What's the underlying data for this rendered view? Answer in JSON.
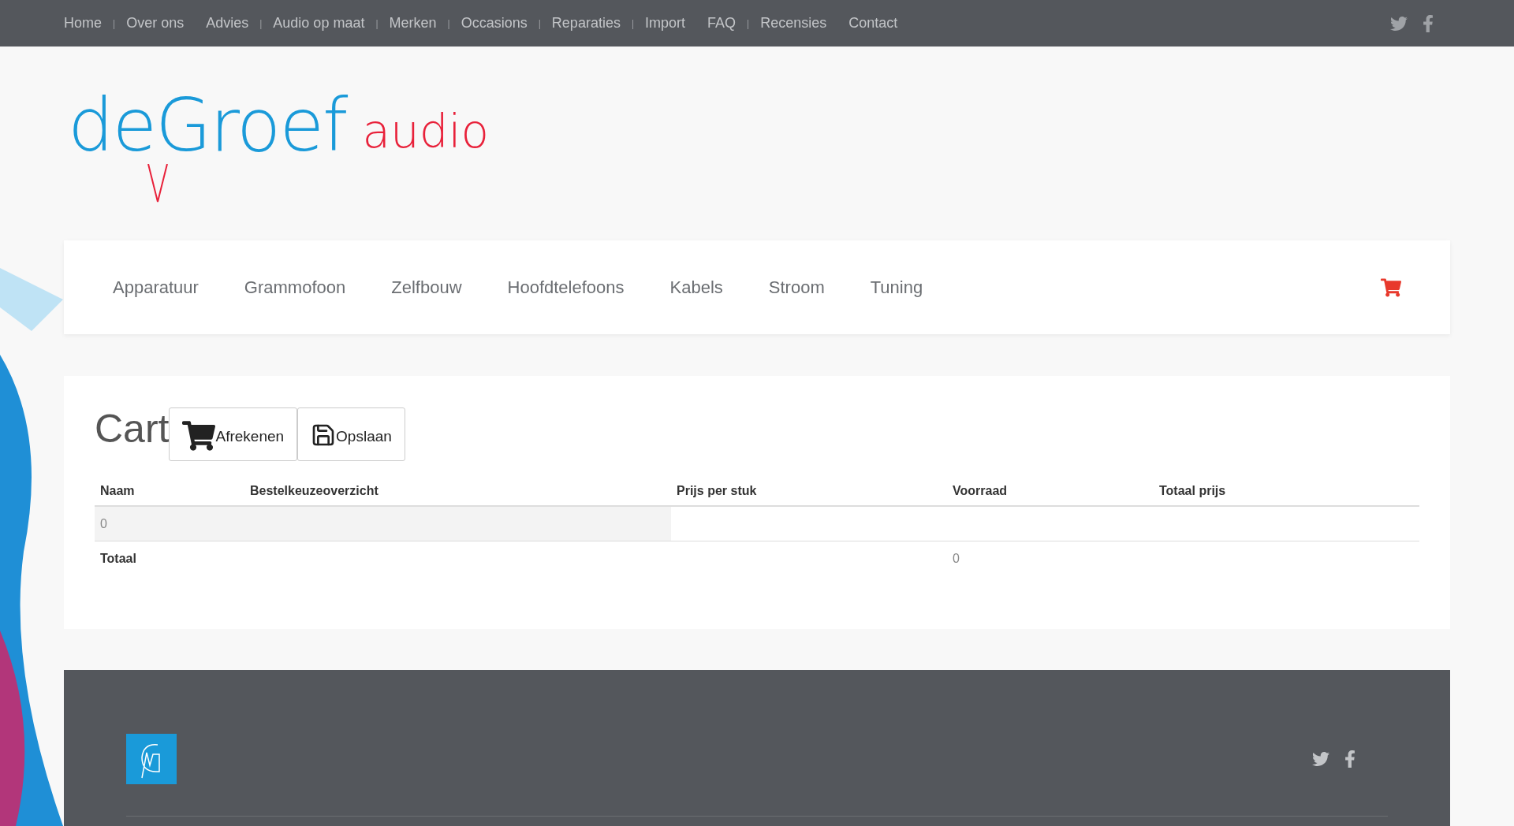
{
  "top_nav": [
    {
      "kind": "link",
      "label": "Home"
    },
    {
      "kind": "separator",
      "label": "|"
    },
    {
      "kind": "link",
      "label": "Over ons"
    },
    {
      "kind": "link",
      "label": "Advies"
    },
    {
      "kind": "separator",
      "label": "|"
    },
    {
      "kind": "link",
      "label": "Audio op maat"
    },
    {
      "kind": "separator",
      "label": "|"
    },
    {
      "kind": "link",
      "label": "Merken"
    },
    {
      "kind": "separator",
      "label": "|"
    },
    {
      "kind": "link",
      "label": "Occasions"
    },
    {
      "kind": "separator",
      "label": "|"
    },
    {
      "kind": "link",
      "label": "Reparaties"
    },
    {
      "kind": "separator",
      "label": "|"
    },
    {
      "kind": "link",
      "label": "Import"
    },
    {
      "kind": "link",
      "label": "FAQ"
    },
    {
      "kind": "separator",
      "label": "|"
    },
    {
      "kind": "link",
      "label": "Recensies"
    },
    {
      "kind": "link",
      "label": "Contact"
    }
  ],
  "logo": {
    "name": "deGroef",
    "suffix": "audio"
  },
  "categories": [
    "Apparatuur",
    "Grammofoon",
    "Zelfbouw",
    "Hoofdtelefoons",
    "Kabels",
    "Stroom",
    "Tuning"
  ],
  "cart": {
    "title": "Cart",
    "buttons": [
      {
        "kind": "checkout",
        "label": "Afrekenen"
      },
      {
        "kind": "save",
        "label": "Opslaan"
      }
    ],
    "columns": [
      "Naam",
      "Bestelkeuzeoverzicht",
      "Prijs per stuk",
      "Voorraad",
      "Totaal prijs"
    ],
    "empty_row": "0",
    "total_label": "Totaal",
    "total_value": "0"
  }
}
